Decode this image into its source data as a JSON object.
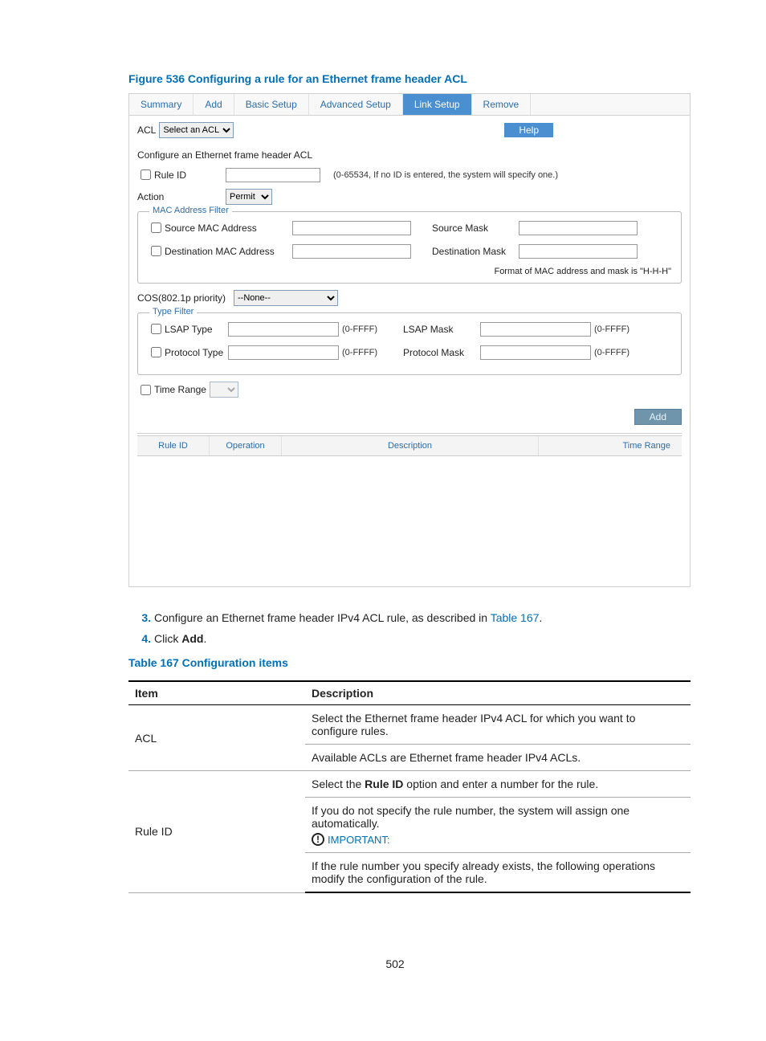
{
  "figure_title": "Figure 536 Configuring a rule for an Ethernet frame header ACL",
  "tabs": {
    "summary": "Summary",
    "add": "Add",
    "basic": "Basic Setup",
    "advanced": "Advanced Setup",
    "link": "Link Setup",
    "remove": "Remove"
  },
  "acl_label": "ACL",
  "acl_select_default": "Select an ACL",
  "help_btn": "Help",
  "section_title": "Configure an Ethernet frame header ACL",
  "rule_id_label": "Rule ID",
  "rule_id_hint": "(0-65534, If no ID is entered, the system will specify one.)",
  "action_label": "Action",
  "action_value": "Permit",
  "mac_filter": {
    "legend": "MAC Address Filter",
    "src_mac": "Source MAC Address",
    "src_mask": "Source Mask",
    "dst_mac": "Destination MAC Address",
    "dst_mask": "Destination Mask",
    "format_note": "Format of MAC address and mask is \"H-H-H\""
  },
  "cos_label": "COS(802.1p priority)",
  "cos_value": "--None--",
  "type_filter": {
    "legend": "Type Filter",
    "lsap_type": "LSAP Type",
    "lsap_mask": "LSAP Mask",
    "proto_type": "Protocol Type",
    "proto_mask": "Protocol Mask",
    "range_hint": "(0-FFFF)"
  },
  "time_range_label": "Time Range",
  "add_btn": "Add",
  "rule_table": {
    "rid": "Rule ID",
    "op": "Operation",
    "desc": "Description",
    "tr": "Time Range"
  },
  "steps": {
    "s3_pre": "Configure an Ethernet frame header IPv4 ACL rule, as described in ",
    "s3_link": "Table 167",
    "s3_post": ".",
    "s4_pre": "Click ",
    "s4_bold": "Add",
    "s4_post": "."
  },
  "table_title": "Table 167 Configuration items",
  "cfg_table": {
    "hdr_item": "Item",
    "hdr_desc": "Description",
    "acl_item": "ACL",
    "acl_desc_a": "Select the Ethernet frame header IPv4 ACL for which you want to configure rules.",
    "acl_desc_b": "Available ACLs are Ethernet frame header IPv4 ACLs.",
    "rid_item": "Rule ID",
    "rid_desc_a_pre": "Select the ",
    "rid_desc_a_bold": "Rule ID",
    "rid_desc_a_post": " option and enter a number for the rule.",
    "rid_desc_b": "If you do not specify the rule number, the system will assign one automatically.",
    "important": "IMPORTANT:",
    "rid_desc_c": "If the rule number you specify already exists, the following operations modify the configuration of the rule."
  },
  "page_number": "502"
}
